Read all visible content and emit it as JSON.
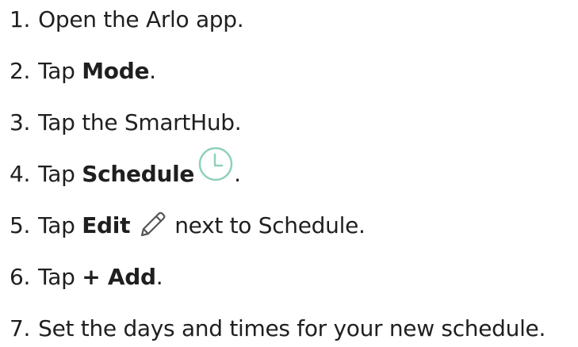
{
  "steps": [
    {
      "number": "1.",
      "text": "Open the Arlo app."
    },
    {
      "number": "2.",
      "prefix": "Tap ",
      "bold": "Mode",
      "suffix": "."
    },
    {
      "number": "3.",
      "text": "Tap the SmartHub."
    },
    {
      "number": "4.",
      "prefix": "Tap ",
      "bold": "Schedule",
      "suffix": ".",
      "icon": "clock-icon"
    },
    {
      "number": "5.",
      "prefix": "Tap ",
      "bold": "Edit",
      "suffix": "next to Schedule.",
      "icon": "pencil-icon"
    },
    {
      "number": "6.",
      "prefix": "Tap ",
      "bold": "+ Add",
      "suffix": "."
    },
    {
      "number": "7.",
      "text": "Set the days and times for your new schedule."
    }
  ],
  "colors": {
    "text": "#1f1f1f",
    "clock_icon": "#8fd1b8",
    "pencil_icon": "#555555"
  }
}
